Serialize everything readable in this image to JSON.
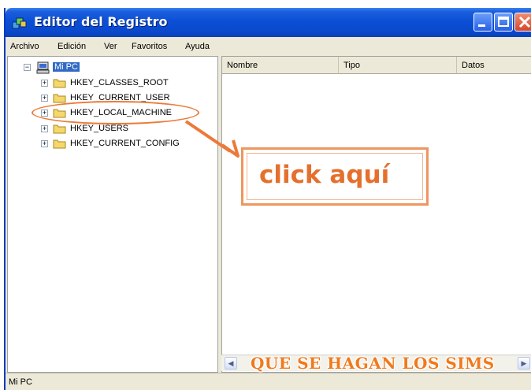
{
  "window": {
    "title": "Editor del Registro"
  },
  "menu": [
    "Archivo",
    "Edición",
    "Ver",
    "Favoritos",
    "Ayuda"
  ],
  "tree": {
    "root": "Mi PC",
    "keys": [
      "HKEY_CLASSES_ROOT",
      "HKEY_CURRENT_USER",
      "HKEY_LOCAL_MACHINE",
      "HKEY_USERS",
      "HKEY_CURRENT_CONFIG"
    ]
  },
  "columns": [
    "Nombre",
    "Tipo",
    "Datos"
  ],
  "status": "Mi PC",
  "callout": "click aquí",
  "watermark": "QUE SE HAGAN LOS SIMS",
  "colors": {
    "titlebar": "#0b4fd6",
    "selection": "#316ac5",
    "annotation": "#ec7a3a"
  },
  "icons": {
    "app": "registry-editor-icon",
    "computer": "computer-icon",
    "folder": "folder-icon",
    "expand": "plus-expander-icon",
    "collapse": "minus-expander-icon"
  }
}
